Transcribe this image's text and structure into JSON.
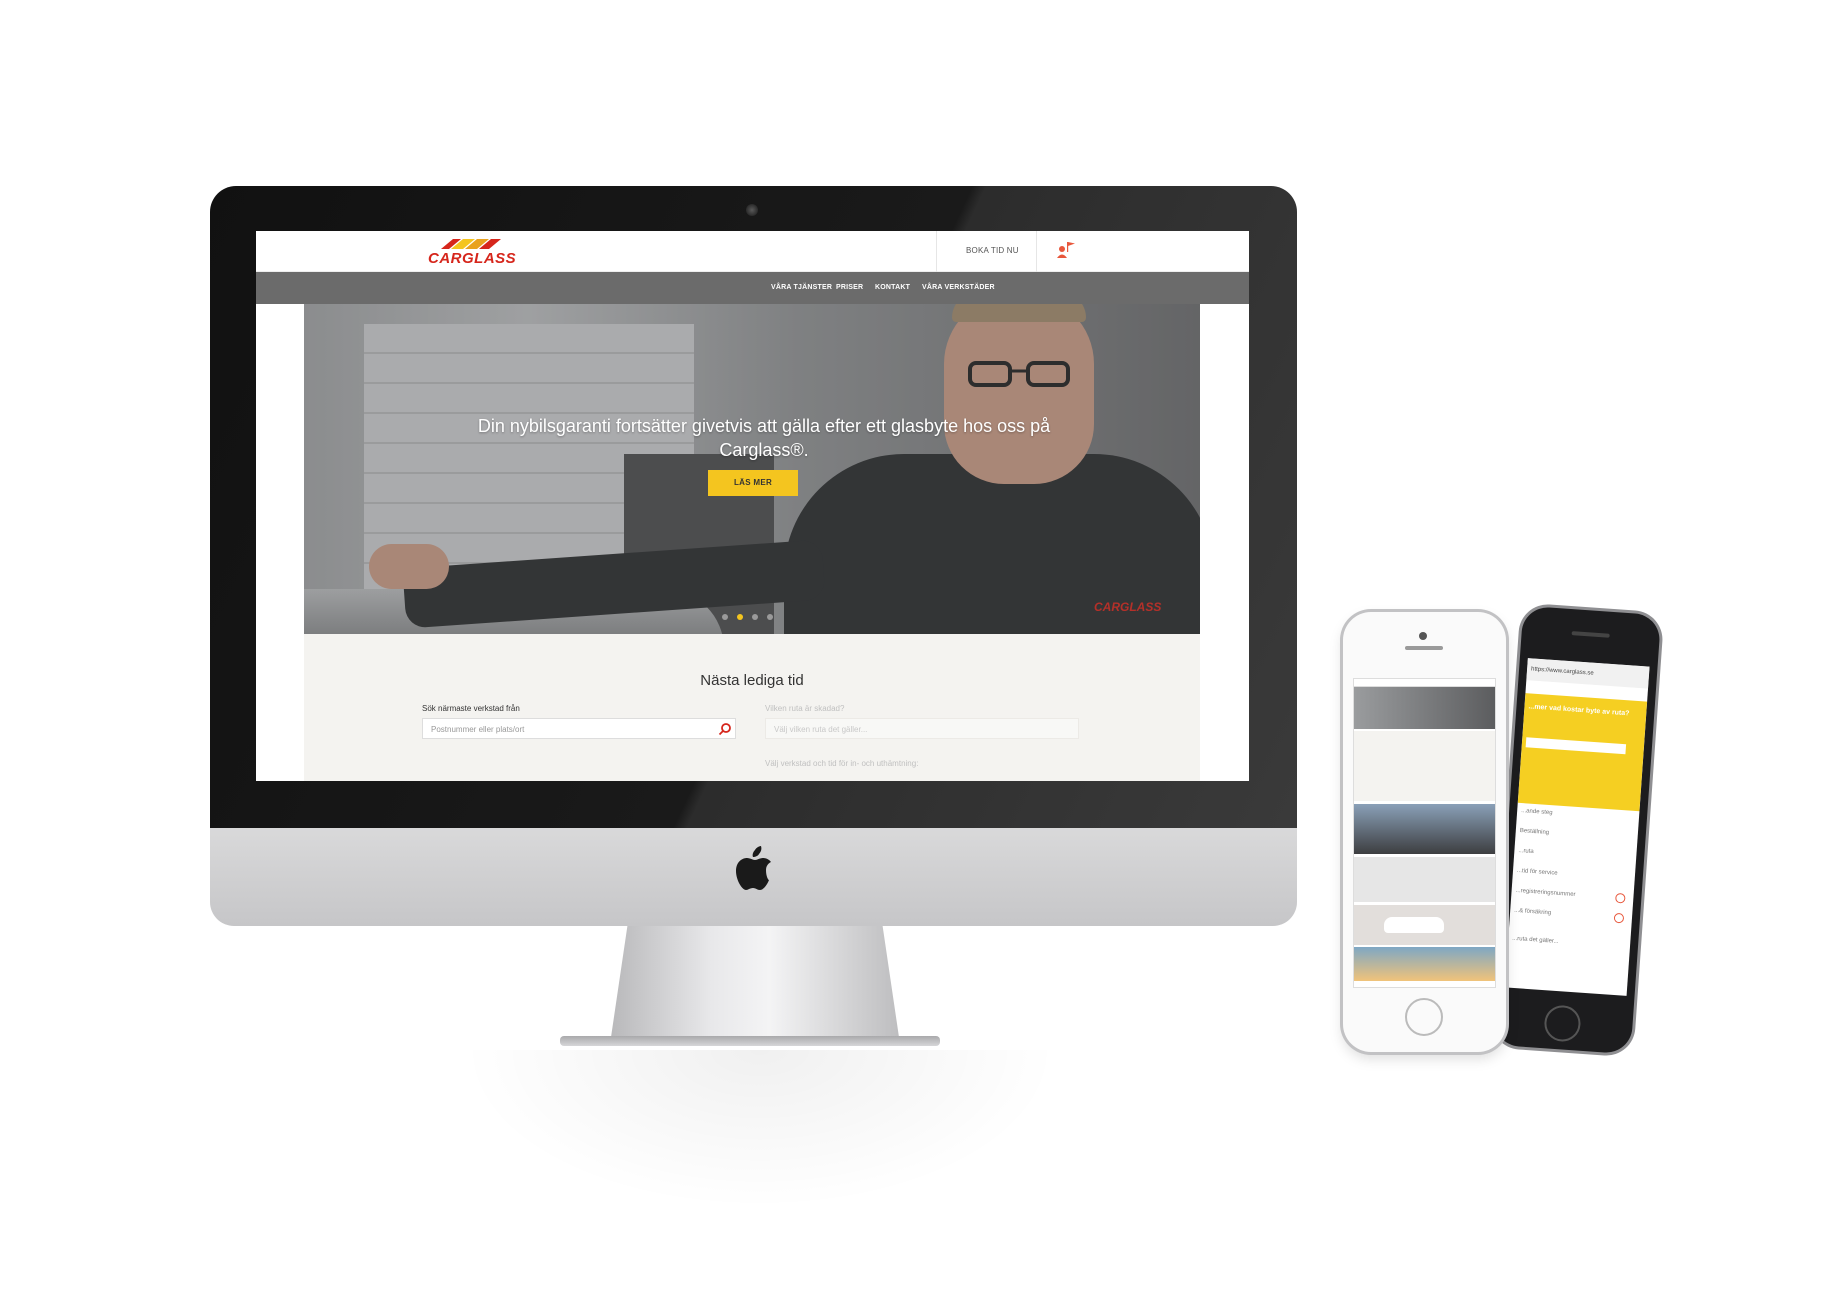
{
  "site": {
    "logo_text": "CARGLASS",
    "book_now": "BOKA TID NU",
    "nav": [
      "VÅRA TJÄNSTER",
      "PRISER",
      "KONTAKT",
      "VÅRA VERKSTÄDER"
    ],
    "hero": {
      "title": "Din nybilsgaranti fortsätter givetvis att gälla efter ett glasbyte hos oss på Carglass®.",
      "button": "LÄS MER",
      "slides": 4,
      "active_slide": 2,
      "jacket_logo": "CARGLASS"
    },
    "booking": {
      "title": "Nästa lediga tid",
      "search_label": "Sök närmaste verkstad från",
      "search_placeholder": "Postnummer eller plats/ort",
      "window_label": "Vilken ruta är skadad?",
      "window_placeholder": "Välj vilken ruta det gäller...",
      "workshop_label": "Välj verkstad och tid för in- och uthämtning:"
    }
  },
  "phone_black": {
    "url": "https://www.carglass.se",
    "yellow_heading": "...mer vad kostar byte av ruta?",
    "rows": [
      "...ande steg",
      "Beställning",
      "...ruta",
      "...tid för service",
      "...registreringsnummer",
      "...& försäkring"
    ],
    "select": "...ruta det gäller..."
  },
  "colors": {
    "brand_red": "#d6261c",
    "accent_yellow": "#f4c51f",
    "nav_gray": "#6b6b6b",
    "booking_bg": "#f4f3f0"
  }
}
